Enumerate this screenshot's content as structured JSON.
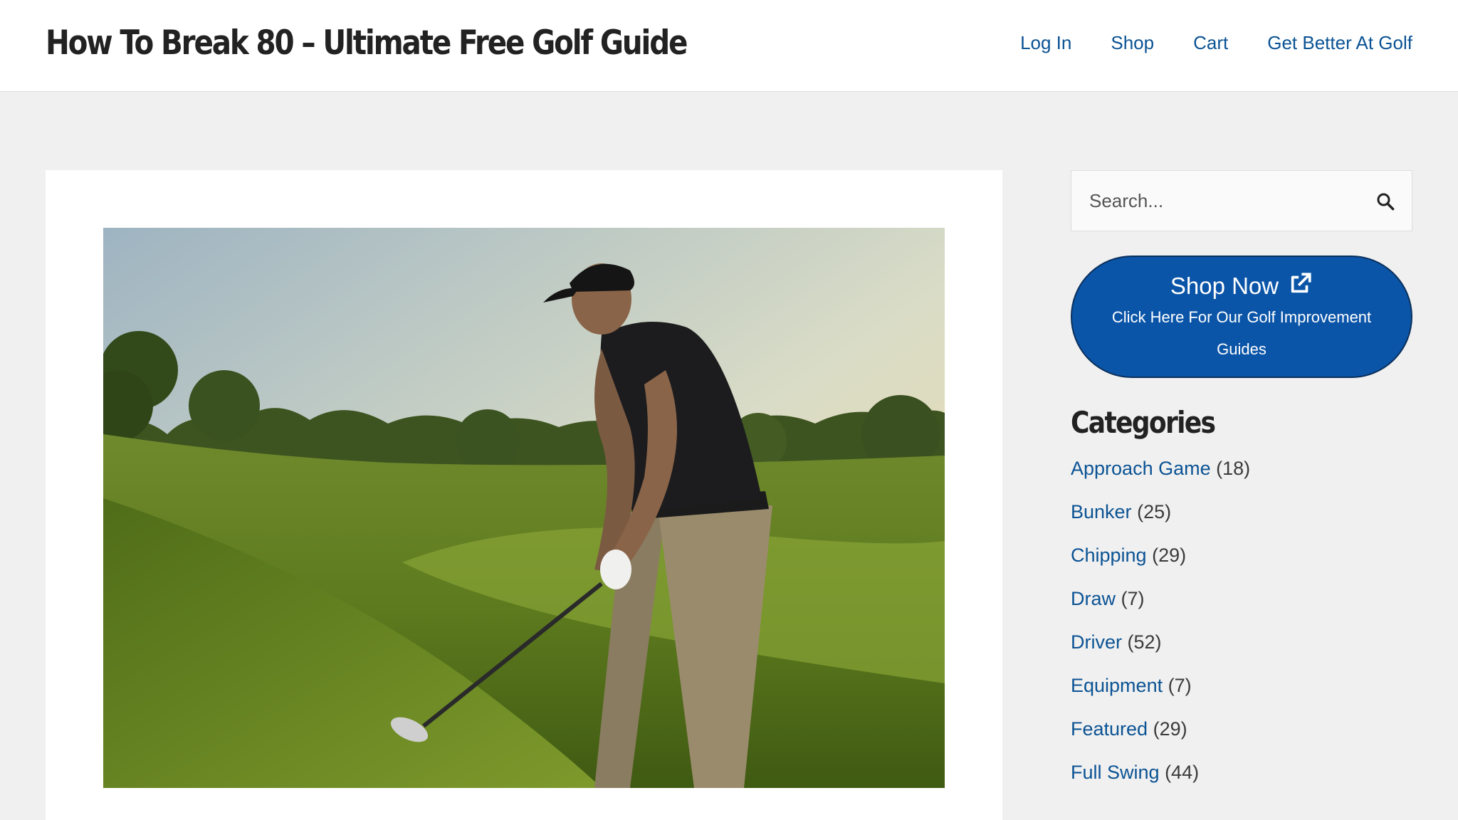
{
  "header": {
    "site_title": "How To Break 80 – Ultimate Free Golf Guide",
    "nav": [
      {
        "label": "Log In"
      },
      {
        "label": "Shop"
      },
      {
        "label": "Cart"
      },
      {
        "label": "Get Better At Golf"
      }
    ]
  },
  "main": {
    "featured_image": {
      "icon": "golfer-photo"
    }
  },
  "sidebar": {
    "search": {
      "placeholder": "Search...",
      "icon": "search-icon"
    },
    "shop_button": {
      "title": "Shop Now",
      "subtitle": "Click Here For Our Golf Improvement Guides",
      "icon": "external-link-icon"
    },
    "categories": {
      "heading": "Categories",
      "items": [
        {
          "name": "Approach Game",
          "count": "(18)"
        },
        {
          "name": "Bunker",
          "count": "(25)"
        },
        {
          "name": "Chipping",
          "count": "(29)"
        },
        {
          "name": "Draw",
          "count": "(7)"
        },
        {
          "name": "Driver",
          "count": "(52)"
        },
        {
          "name": "Equipment",
          "count": "(7)"
        },
        {
          "name": "Featured",
          "count": "(29)"
        },
        {
          "name": "Full Swing",
          "count": "(44)"
        }
      ]
    }
  },
  "colors": {
    "link": "#0b5394",
    "button_bg": "#0b55a8",
    "page_bg": "#f0f0f0"
  }
}
